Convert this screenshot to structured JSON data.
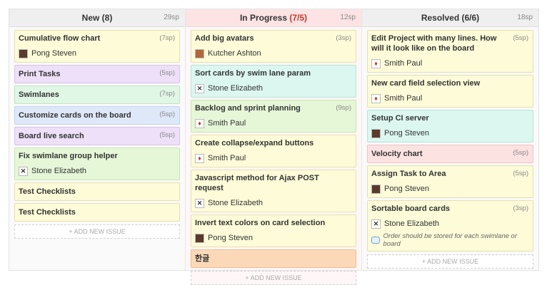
{
  "columns": [
    {
      "name": "New (8)",
      "sp": "29sp",
      "add_label": "+ ADD NEW ISSUE",
      "cards": [
        {
          "title": "Cumulative flow chart",
          "sp": "(7sp)",
          "assignee": "Pong Steven",
          "color": "#fdfbd8"
        },
        {
          "title": "Print Tasks",
          "sp": "(5sp)",
          "color": "#eee0f8"
        },
        {
          "title": "Swimlanes",
          "sp": "(7sp)",
          "color": "#e0f7e5"
        },
        {
          "title": "Customize cards on the board",
          "sp": "(5sp)",
          "color": "#dfe8f9"
        },
        {
          "title": "Board live search",
          "sp": "(5sp)",
          "color": "#eee0f8"
        },
        {
          "title": "Fix swimlane group helper",
          "assignee": "Stone Elizabeth",
          "color": "#e6f7d8"
        },
        {
          "title": "Test Checklists",
          "color": "#fdfbd8"
        },
        {
          "title": "Test Checklists",
          "color": "#fdfbd8"
        }
      ]
    },
    {
      "name_prefix": "In Progress ",
      "name_limit": "(7/5)",
      "sp": "12sp",
      "add_label": "+ ADD NEW ISSUE",
      "cards": [
        {
          "title": "Add big avatars",
          "sp": "(3sp)",
          "assignee": "Kutcher Ashton",
          "color": "#fdfbd8"
        },
        {
          "title": "Sort cards by swim lane param",
          "assignee": "Stone Elizabeth",
          "color": "#dcf7f0"
        },
        {
          "title": "Backlog and sprint planning",
          "sp": "(9sp)",
          "assignee": "Smith Paul",
          "color": "#e6f7d8"
        },
        {
          "title": "Create collapse/expand buttons",
          "assignee": "Smith Paul",
          "color": "#fdfbd8"
        },
        {
          "title": "Javascript method for Ajax POST request",
          "assignee": "Stone Elizabeth",
          "color": "#fdfbd8"
        },
        {
          "title": "Invert text colors on card selection",
          "assignee": "Pong Steven",
          "color": "#fdfbd8"
        },
        {
          "title": "한글",
          "color": "#fbd9b8"
        }
      ]
    },
    {
      "name": "Resolved (6/6)",
      "sp": "18sp",
      "add_label": "+ ADD NEW ISSUE",
      "cards": [
        {
          "title": "Edit Project with many lines. How will it look like on the board",
          "sp": "(5sp)",
          "assignee": "Smith Paul",
          "color": "#fdfbd8"
        },
        {
          "title": "New card field selection view",
          "assignee": "Smith Paul",
          "color": "#fdfbd8"
        },
        {
          "title": "Setup CI server",
          "assignee": "Pong Steven",
          "color": "#dcf7f0"
        },
        {
          "title": "Velocity chart",
          "sp": "(5sp)",
          "color": "#fde2e2"
        },
        {
          "title": "Assign Task to Area",
          "sp": "(5sp)",
          "assignee": "Pong Steven",
          "color": "#fdfbd8"
        },
        {
          "title": "Sortable board cards",
          "sp": "(3sp)",
          "assignee": "Stone Elizabeth",
          "note": "Order should be stored for each swimlane or board",
          "color": "#fdfbd8"
        }
      ]
    }
  ]
}
